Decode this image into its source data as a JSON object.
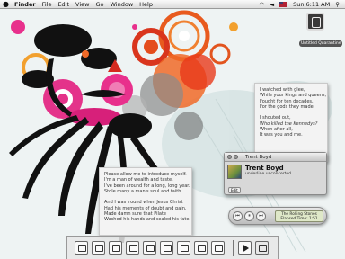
{
  "menubar": {
    "apple_glyph": "",
    "items": [
      "Finder",
      "File",
      "Edit",
      "View",
      "Go",
      "Window",
      "Help"
    ],
    "clock": "Sun 6:11 AM"
  },
  "desktop": {
    "drive_label": "Untitled Quarantine"
  },
  "sticky_right": {
    "lines": [
      "I watched with glee,",
      "While your kings and queens,",
      "Fought for ten decades,",
      "For the gods they made.",
      "",
      "I shouted out,",
      "Who killed the Kennedys?",
      "When after all,",
      "It was you and me."
    ]
  },
  "sticky_left": {
    "lines": [
      "Please allow me to introduce myself.",
      "I'm a man of wealth and taste.",
      "I've been around for a long, long year.",
      "Stole many a man's soul and faith.",
      "",
      "And I was 'round when Jesus Christ",
      "Had his moments of doubt and pain.",
      "Made damn sure that Pilate",
      "Washed his hands and sealed his fate."
    ]
  },
  "itunes_window": {
    "title": "Trent Boyd",
    "artist": "Trent Boyd",
    "subtitle": "underline.unconcerted",
    "edit_label": "Edit"
  },
  "player": {
    "prev": "⏮",
    "pause": "⏸",
    "next": "⏭",
    "track": "The Rolling Stones",
    "elapsed": "Elapsed Time: 1:51"
  }
}
